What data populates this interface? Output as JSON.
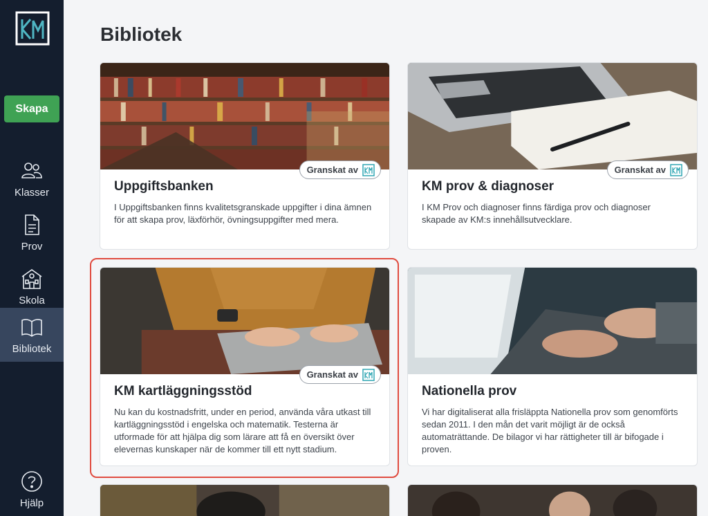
{
  "sidebar": {
    "logo": "km-logo",
    "create_label": "Skapa",
    "items": [
      {
        "label": "Klasser",
        "icon": "people-icon"
      },
      {
        "label": "Prov",
        "icon": "document-icon"
      },
      {
        "label": "Skola",
        "icon": "school-icon"
      },
      {
        "label": "Bibliotek",
        "icon": "book-icon",
        "active": true
      },
      {
        "label": "Hjälp",
        "icon": "help-icon"
      }
    ]
  },
  "page": {
    "title": "Bibliotek"
  },
  "cards": [
    {
      "title": "Uppgiftsbanken",
      "badge": "Granskat av",
      "description": "I Uppgiftsbanken finns kvalitetsgranskade uppgifter i dina ämnen för att skapa prov, läxförhör, övningsuppgifter med mera.",
      "image": "library-bookshelves-photo"
    },
    {
      "title": "KM prov & diagnoser",
      "badge": "Granskat av",
      "description": "I KM Prov och diagnoser finns färdiga prov och diagnoser skapade av KM:s innehållsutvecklare.",
      "image": "laptop-notebook-photo"
    },
    {
      "title": "KM kartläggningsstöd",
      "badge": "Granskat av",
      "description": "Nu kan du kostnadsfritt, under en period, använda våra utkast till kartläggningsstöd i engelska och matematik. Testerna är utformade för att hjälpa dig som lärare att få en översikt över elevernas kunskaper när de kommer till ett nytt stadium.",
      "image": "person-typing-laptop-photo"
    },
    {
      "title": "Nationella prov",
      "description": "Vi har digitaliserat alla frisläppta Nationella prov som genomförts sedan 2011. I den mån det varit möjligt är de också automaträttande. De bilagor vi har rättigheter till är bifogade i proven.",
      "image": "hands-keyboard-photo"
    }
  ],
  "colors": {
    "sidebar": "#141e2e",
    "active_nav": "#37465e",
    "create": "#3fa254",
    "highlight": "#e04b3f",
    "brand_teal": "#2fa6b3"
  }
}
